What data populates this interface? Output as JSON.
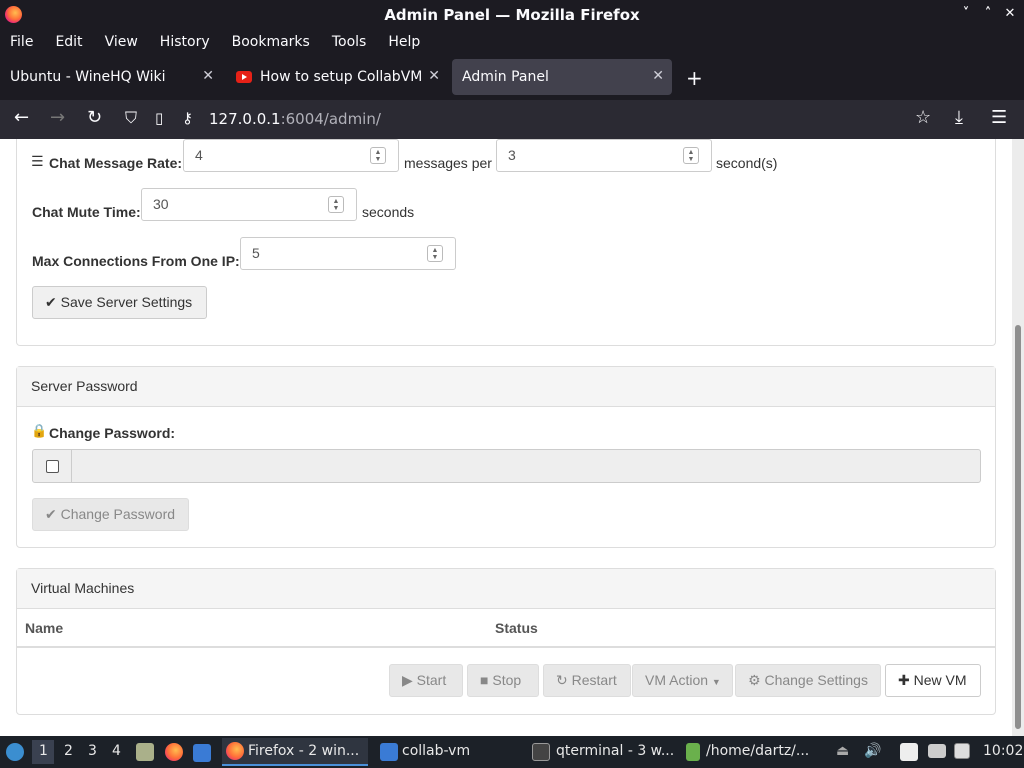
{
  "window": {
    "title": "Admin Panel — Mozilla Firefox",
    "controls": [
      "˅",
      "˄",
      "✕"
    ]
  },
  "menu": [
    "File",
    "Edit",
    "View",
    "History",
    "Bookmarks",
    "Tools",
    "Help"
  ],
  "tabs": [
    {
      "label": "Ubuntu - WineHQ Wiki"
    },
    {
      "label": "How to setup CollabVM S"
    },
    {
      "label": "Admin Panel"
    }
  ],
  "address": {
    "host": "127.0.0.1",
    "rest": ":6004/admin/"
  },
  "settings": {
    "chat_rate_label": "Chat Message Rate:",
    "chat_rate_value": "4",
    "messages_per": "messages per",
    "chat_rate_seconds": "3",
    "seconds_suffix": "second(s)",
    "mute_label": "Chat Mute Time:",
    "mute_value": "30",
    "mute_unit": "seconds",
    "max_conn_label": "Max Connections From One IP:",
    "max_conn_value": "5",
    "save_label": "Save Server Settings"
  },
  "password": {
    "heading": "Server Password",
    "label": "Change Password:",
    "button": "Change Password"
  },
  "vms": {
    "heading": "Virtual Machines",
    "col_name": "Name",
    "col_status": "Status",
    "start": "Start",
    "stop": "Stop",
    "restart": "Restart",
    "action": "VM Action",
    "change": "Change Settings",
    "new": "New VM"
  },
  "taskbar": {
    "workspaces": [
      "1",
      "2",
      "3",
      "4"
    ],
    "items": [
      "Firefox - 2 win...",
      "collab-vm",
      "qterminal - 3 w...",
      "/home/dartz/..."
    ],
    "clock": "10:02"
  }
}
